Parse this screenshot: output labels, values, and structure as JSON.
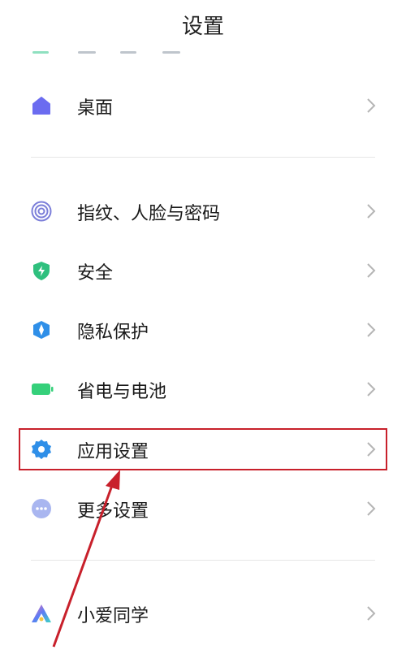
{
  "header": {
    "title": "设置"
  },
  "rows": [
    {
      "label": "桌面",
      "icon": "home-icon",
      "color": "#6b6cf0"
    },
    {
      "label": "指纹、人脸与密码",
      "icon": "fingerprint-icon",
      "color": "#7b7ed9"
    },
    {
      "label": "安全",
      "icon": "shield-icon",
      "color": "#2fc07e"
    },
    {
      "label": "隐私保护",
      "icon": "privacy-icon",
      "color": "#2f8fe8"
    },
    {
      "label": "省电与电池",
      "icon": "battery-icon",
      "color": "#35d07a"
    },
    {
      "label": "应用设置",
      "icon": "gear-icon",
      "color": "#2f8fe8"
    },
    {
      "label": "更多设置",
      "icon": "more-dots-icon",
      "color": "#a9b6f0"
    },
    {
      "label": "小爱同学",
      "icon": "xiaoai-icon",
      "color": "#5b7cf5"
    }
  ],
  "annotation": {
    "highlighted_item": "应用设置",
    "color": "#c8202b"
  }
}
